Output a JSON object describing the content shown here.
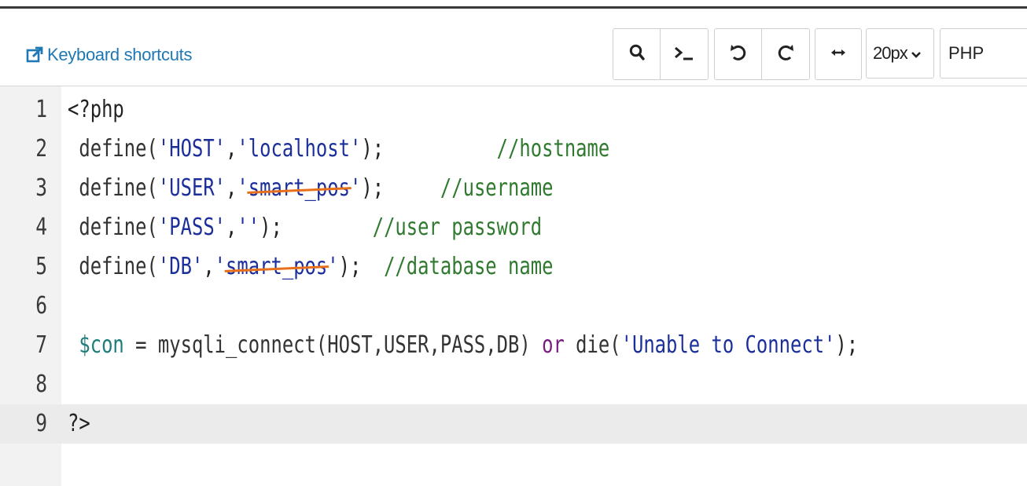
{
  "toolbar": {
    "keyboard_shortcuts_label": "Keyboard shortcuts",
    "font_size_value": "20px",
    "language_value": "PHP",
    "buttons": [
      "search-icon",
      "terminal-icon",
      "undo-icon",
      "redo-icon",
      "wrap-icon"
    ]
  },
  "editor": {
    "line_numbers": [
      "1",
      "2",
      "3",
      "4",
      "5",
      "6",
      "7",
      "8",
      "9"
    ],
    "lines": {
      "l1": "<?php",
      "l2_fn": "define(",
      "l2_s1": "'HOST'",
      "l2_comma": ",",
      "l2_s2": "'localhost'",
      "l2_end": ");",
      "l2_pad": "          ",
      "l2_cm": "//hostname",
      "l3_fn": "define(",
      "l3_s1": "'USER'",
      "l3_comma": ",",
      "l3_q1": "'",
      "l3_redacted": "smart_pos",
      "l3_q2": "'",
      "l3_end": ");",
      "l3_pad": "     ",
      "l3_cm": "//username",
      "l4_fn": "define(",
      "l4_s1": "'PASS'",
      "l4_comma": ",",
      "l4_s2": "''",
      "l4_end": ");",
      "l4_pad": "        ",
      "l4_cm": "//user password",
      "l5_fn": "define(",
      "l5_s1": "'DB'",
      "l5_comma": ",",
      "l5_q1": "'",
      "l5_redacted": "smart_pos",
      "l5_q2": "'",
      "l5_end": ");",
      "l5_pad": "  ",
      "l5_cm": "//database name",
      "l7_var": "$con",
      "l7_eq": " = mysqli_connect(HOST,USER,PASS,DB) ",
      "l7_kw": "or",
      "l7_die": " die(",
      "l7_str": "'Unable to Connect'",
      "l7_end": ");",
      "l9": "?>"
    },
    "colors": {
      "keyword": "#771b7d",
      "string": "#1b2f9a",
      "comment": "#2f7a2f",
      "variable": "#1c7d7a",
      "strike": "#e8701a",
      "link": "#1f78b4"
    }
  }
}
